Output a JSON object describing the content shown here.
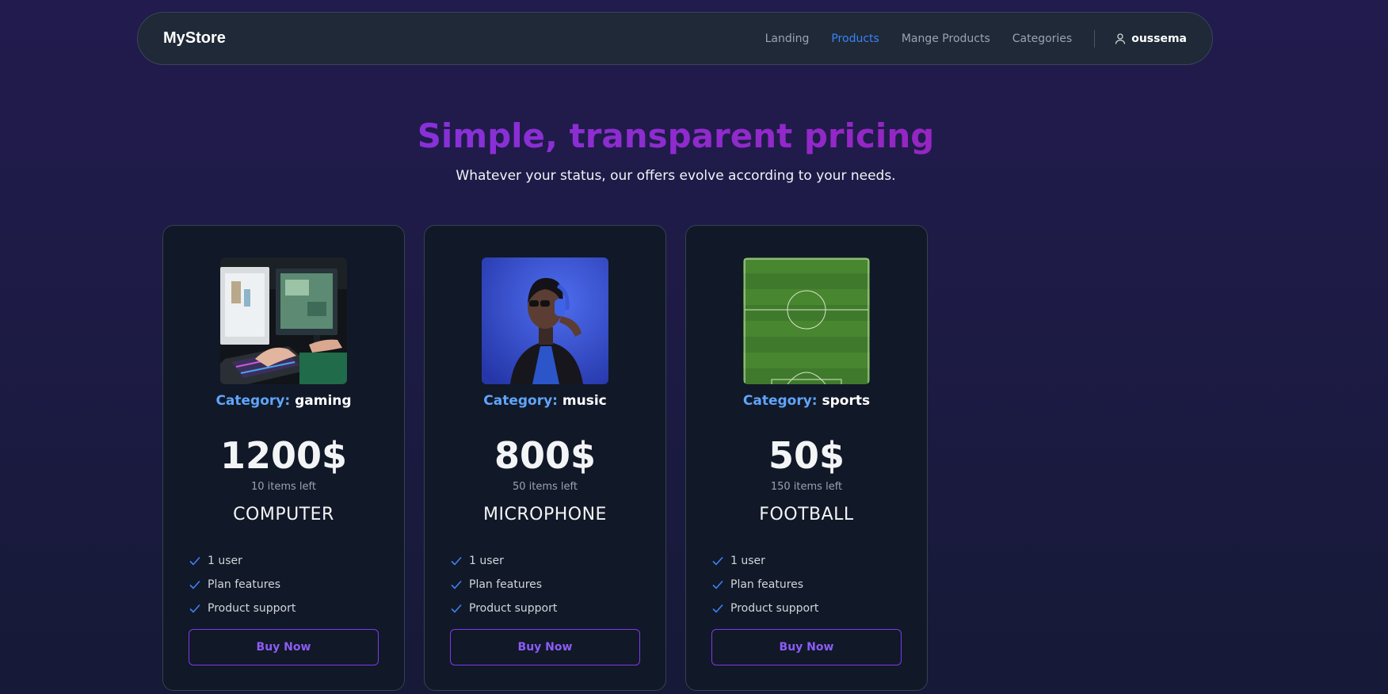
{
  "navbar": {
    "brand": "MyStore",
    "links": [
      {
        "label": "Landing",
        "active": false
      },
      {
        "label": "Products",
        "active": true
      },
      {
        "label": "Mange Products",
        "active": false
      },
      {
        "label": "Categories",
        "active": false
      }
    ],
    "user": {
      "name": "oussema",
      "icon": "user-icon"
    }
  },
  "hero": {
    "title": "Simple, transparent pricing",
    "subtitle": "Whatever your status, our offers evolve according to your needs."
  },
  "category_label": "Category:",
  "products": [
    {
      "category": "gaming",
      "price": "1200$",
      "stock": "10 items left",
      "name": "COMPUTER",
      "image": "gaming-setup-photo",
      "features": [
        "1 user",
        "Plan features",
        "Product support"
      ],
      "button": "Buy Now"
    },
    {
      "category": "music",
      "price": "800$",
      "stock": "50 items left",
      "name": "MICROPHONE",
      "image": "woman-with-headphones-photo",
      "features": [
        "1 user",
        "Plan features",
        "Product support"
      ],
      "button": "Buy Now"
    },
    {
      "category": "sports",
      "price": "50$",
      "stock": "150 items left",
      "name": "FOOTBALL",
      "image": "football-field-photo",
      "features": [
        "1 user",
        "Plan features",
        "Product support"
      ],
      "button": "Buy Now"
    }
  ],
  "colors": {
    "accent": "#3b82f6",
    "category_label": "#60a5fa",
    "button_border": "#7c3aed",
    "title_gradient_start": "#7c3aed",
    "title_gradient_end": "#a21caf",
    "check": "#3b82f6"
  }
}
